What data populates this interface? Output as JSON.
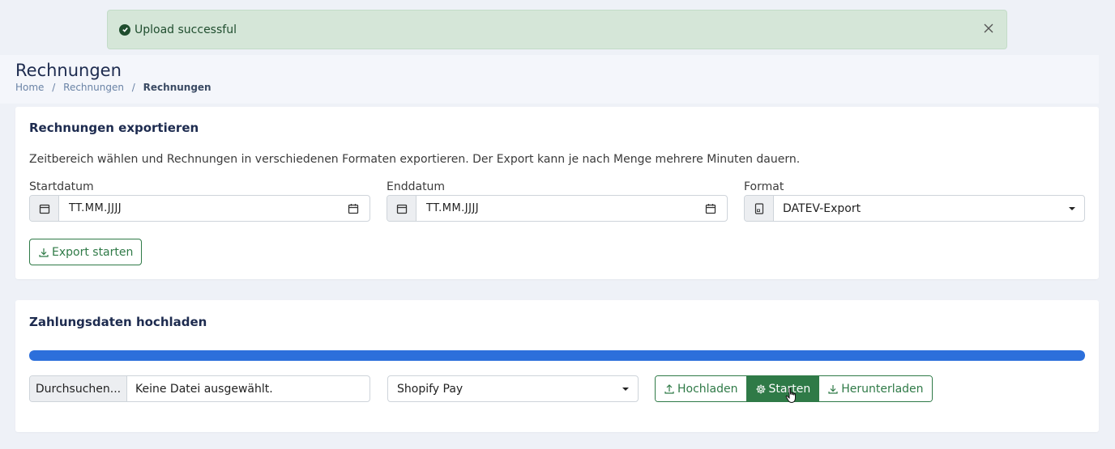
{
  "alert": {
    "message": "Upload successful",
    "icon": "check-circle-icon",
    "close_icon": "close-icon"
  },
  "header": {
    "title": "Rechnungen",
    "breadcrumb": [
      "Home",
      "Rechnungen",
      "Rechnungen"
    ],
    "separator": "/"
  },
  "export_card": {
    "title": "Rechnungen exportieren",
    "description": "Zeitbereich wählen und Rechnungen in verschiedenen Formaten exportieren. Der Export kann je nach Menge mehrere Minuten dauern.",
    "start_label": "Startdatum",
    "start_value": "TT.MM.JJJJ",
    "end_label": "Enddatum",
    "end_value": "TT.MM.JJJJ",
    "format_label": "Format",
    "format_value": "DATEV-Export",
    "export_button": "Export starten"
  },
  "upload_card": {
    "title": "Zahlungsdaten hochladen",
    "progress_percent": 100,
    "browse_label": "Durchsuchen...",
    "file_name": "Keine Datei ausgewählt.",
    "provider_value": "Shopify Pay",
    "upload_button": "Hochladen",
    "start_button": "Starten",
    "download_button": "Herunterladen"
  },
  "colors": {
    "accent_green": "#2f7a47",
    "progress_blue": "#2c6fdb",
    "alert_bg": "#d5e6d8",
    "title_navy": "#1d2b4f"
  }
}
